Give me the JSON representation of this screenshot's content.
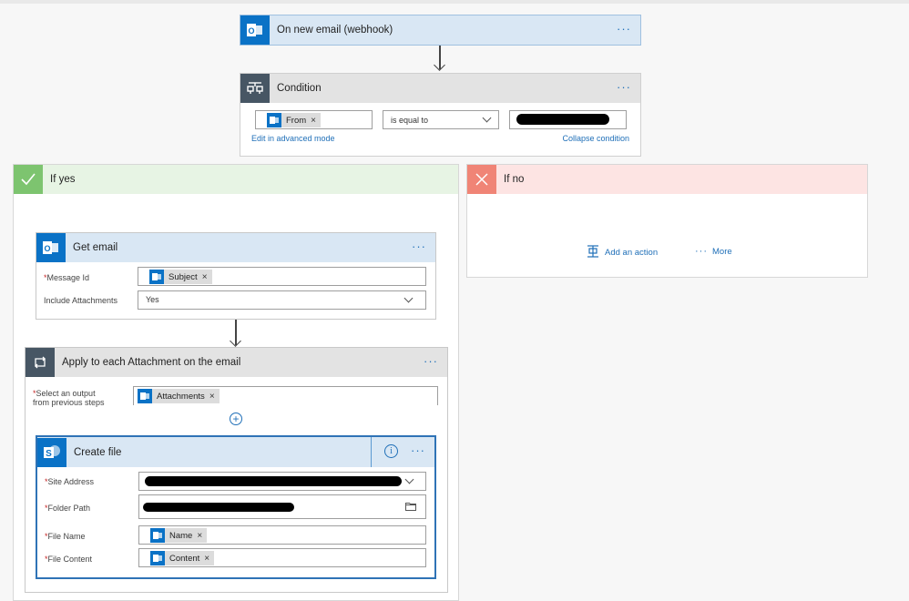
{
  "trigger": {
    "title": "On new email (webhook)",
    "more": "···",
    "icon": "outlook-icon"
  },
  "condition": {
    "title": "Condition",
    "more": "···",
    "left_token": "From",
    "operator": "is equal to",
    "edit_link": "Edit in advanced mode",
    "collapse_link": "Collapse condition"
  },
  "if_yes": {
    "title": "If yes"
  },
  "if_no": {
    "title": "If no",
    "add_action": "Add an action",
    "more": "More"
  },
  "get_email": {
    "title": "Get email",
    "more": "···",
    "message_id_label": "Message Id",
    "message_id_token": "Subject",
    "include_attachments_label": "Include Attachments",
    "include_attachments_value": "Yes"
  },
  "apply_each": {
    "title": "Apply to each Attachment on the email",
    "more": "···",
    "select_label_1": "Select an output",
    "select_label_2": "from previous steps",
    "select_token": "Attachments"
  },
  "create_file": {
    "title": "Create file",
    "more": "···",
    "site_address_label": "Site Address",
    "folder_path_label": "Folder Path",
    "file_name_label": "File Name",
    "file_name_token": "Name",
    "file_content_label": "File Content",
    "file_content_token": "Content"
  },
  "required_mark": "*",
  "token_remove": "×",
  "colors": {
    "accent": "#0a72c6",
    "link": "#1f6fb8",
    "yes": "#7dc46f",
    "no": "#f08476",
    "required": "#c62828"
  }
}
